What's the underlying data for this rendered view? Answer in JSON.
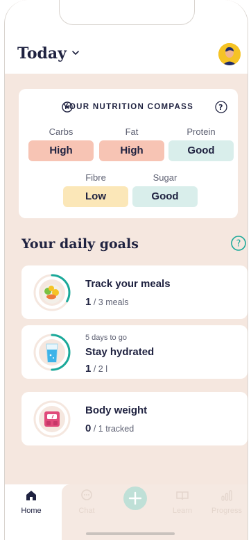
{
  "header": {
    "title": "Today",
    "chevron_icon": "chevron-down-icon",
    "avatar_icon": "user-avatar"
  },
  "compass": {
    "title": "YOUR NUTRITION COMPASS",
    "nav_icon": "navigation-arrow-icon",
    "help_icon": "question-mark-circle-icon",
    "items": [
      {
        "label": "Carbs",
        "status": "High",
        "level": "high"
      },
      {
        "label": "Fat",
        "status": "High",
        "level": "high"
      },
      {
        "label": "Protein",
        "status": "Good",
        "level": "good"
      },
      {
        "label": "Fibre",
        "status": "Low",
        "level": "low"
      },
      {
        "label": "Sugar",
        "status": "Good",
        "level": "good"
      }
    ]
  },
  "goals": {
    "title": "Your daily goals",
    "help_icon": "question-mark-circle-icon",
    "items": [
      {
        "subtitle": "",
        "title": "Track your meals",
        "current": "1",
        "target": "/ 3 meals",
        "icon": "meal-plate-icon",
        "progress": 0.333
      },
      {
        "subtitle": "5 days to go",
        "title": "Stay hydrated",
        "current": "1",
        "target": "/ 2 l",
        "icon": "water-glass-icon",
        "progress": 0.5
      },
      {
        "subtitle": "",
        "title": "Body weight",
        "current": "0",
        "target": "/ 1 tracked",
        "icon": "scale-icon",
        "progress": 0
      }
    ]
  },
  "tabbar": {
    "tabs": [
      {
        "label": "Home",
        "icon": "home-icon",
        "active": true
      },
      {
        "label": "Chat",
        "icon": "chat-bubble-icon",
        "active": false
      },
      {
        "label": "",
        "icon": "plus-icon",
        "active": false
      },
      {
        "label": "Learn",
        "icon": "book-icon",
        "active": false
      },
      {
        "label": "Progress",
        "icon": "bar-chart-icon",
        "active": false
      }
    ]
  },
  "colors": {
    "accent_teal": "#1aa99a",
    "high": "#f7c4b4",
    "good": "#d9eeeb",
    "low": "#fbe7b8",
    "background": "#f5e7df",
    "text_dark": "#1f2240"
  }
}
